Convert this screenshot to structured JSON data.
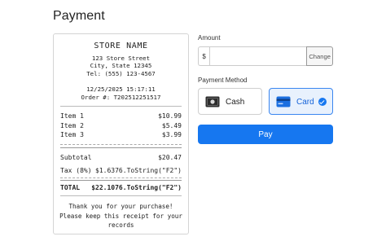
{
  "page": {
    "title": "Payment"
  },
  "receipt": {
    "store_name": "STORE NAME",
    "address_line1": "123 Store Street",
    "address_line2": "City, State 12345",
    "phone": "Tel: (555) 123-4567",
    "datetime": "12/25/2025 15:17:11",
    "order": "Order #: T202512251517",
    "items": [
      {
        "name": "Item 1",
        "price": "$10.99"
      },
      {
        "name": "Item 2",
        "price": "$5.49"
      },
      {
        "name": "Item 3",
        "price": "$3.99"
      }
    ],
    "subtotal_label": "Subtotal",
    "subtotal_value": "$20.47",
    "tax_label": "Tax (8%)",
    "tax_value": "$1.6376.ToString(\"F2\")",
    "total_label": "TOTAL",
    "total_value": "$22.1076.ToString(\"F2\")",
    "footer_line1": "Thank you for your purchase!",
    "footer_line2": "Please keep this receipt for your",
    "footer_line3": "records"
  },
  "amount": {
    "label": "Amount",
    "prefix": "$",
    "value": "",
    "placeholder": "",
    "change_label": "Change"
  },
  "payment_method": {
    "label": "Payment Method",
    "options": [
      {
        "label": "Cash",
        "icon": "cash-icon",
        "selected": false
      },
      {
        "label": "Card",
        "icon": "credit-card-icon",
        "selected": true
      }
    ]
  },
  "pay_button": {
    "label": "Pay"
  },
  "colors": {
    "accent": "#1677f0",
    "selected_bg": "#e8f1fd",
    "selected_border": "#3a86f0"
  }
}
